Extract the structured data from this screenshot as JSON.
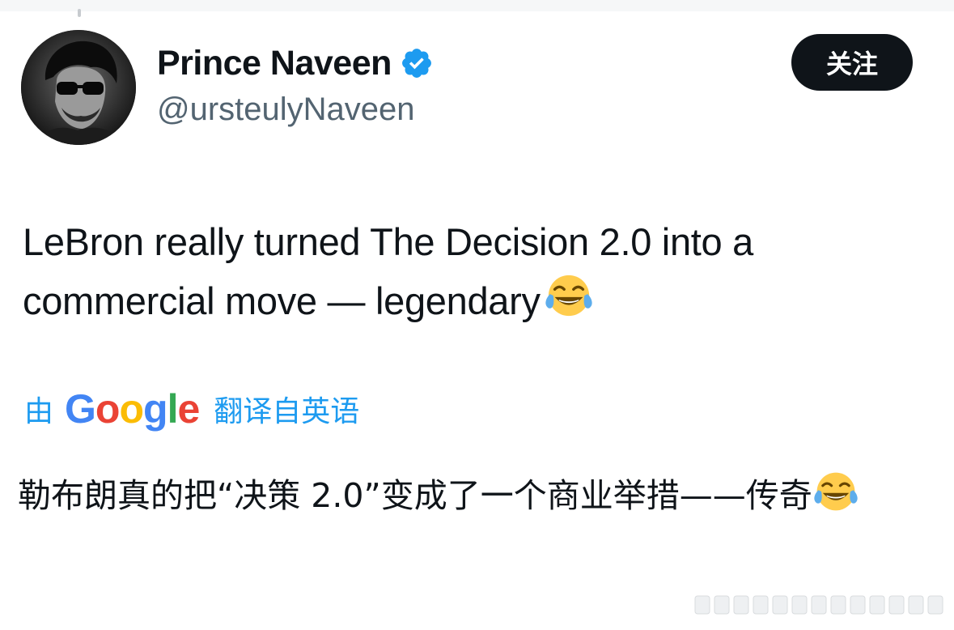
{
  "author": {
    "display_name": "Prince Naveen",
    "handle": "@ursteulyNaveen",
    "verified": true,
    "avatar_icon": "profile-photo",
    "verified_icon": "verified-badge-icon"
  },
  "follow_button": {
    "label": "关注"
  },
  "tweet": {
    "text": "LeBron really turned The Decision 2.0 into a commercial move — legendary",
    "emoji": "face-with-tears-of-joy"
  },
  "translation": {
    "by_label": "由",
    "provider": "Google",
    "from_label": "翻译自英语",
    "translated_text": "勒布朗真的把“决策 2.0”变成了一个商业举措——传奇",
    "emoji": "face-with-tears-of-joy"
  },
  "colors": {
    "text_primary": "#0f1419",
    "text_secondary": "#536471",
    "link_blue": "#1d9bf0",
    "button_bg": "#0f1419",
    "button_text": "#ffffff",
    "verified_blue": "#1d9bf0"
  }
}
